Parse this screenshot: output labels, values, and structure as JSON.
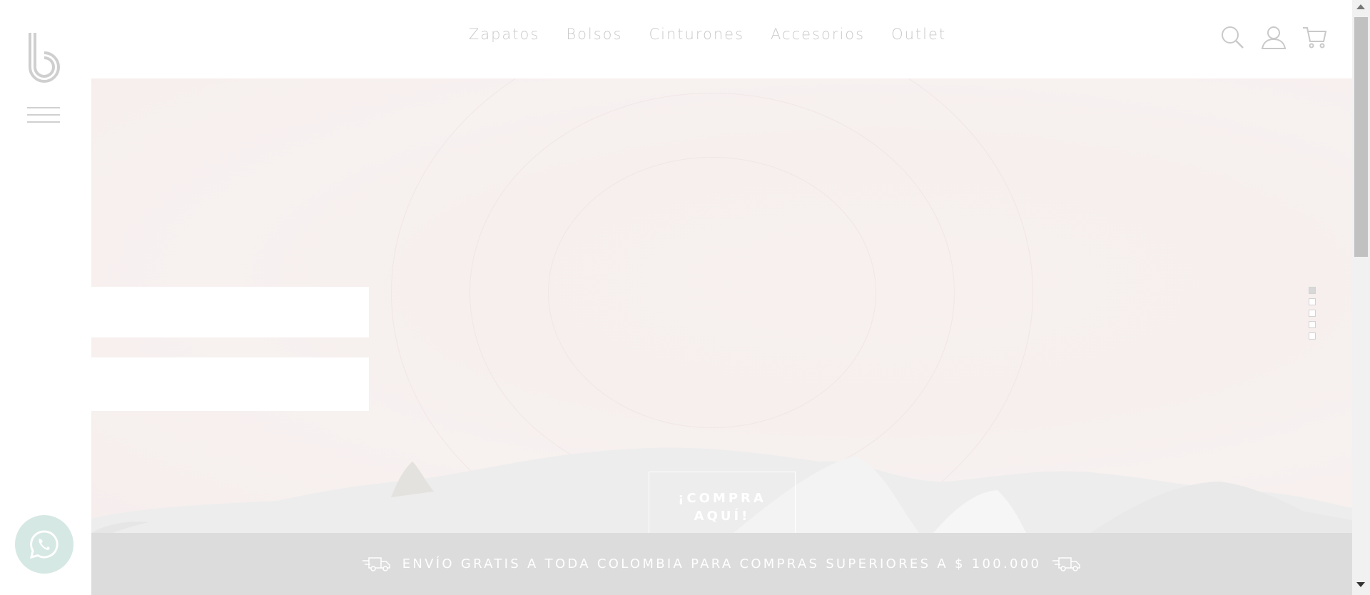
{
  "brand": {
    "logo_icon": "brand-b-logo"
  },
  "nav": {
    "items": [
      {
        "label": "Zapatos"
      },
      {
        "label": "Bolsos"
      },
      {
        "label": "Cinturones"
      },
      {
        "label": "Accesorios"
      },
      {
        "label": "Outlet"
      }
    ]
  },
  "header_icons": [
    "search-icon",
    "user-icon",
    "cart-icon"
  ],
  "hero": {
    "cta_line1": "¡COMPRA",
    "cta_line2": "AQUÍ!",
    "slides_total": 5,
    "active_slide": 1
  },
  "shipping_bar": {
    "text": "ENVÍO GRATIS A TODA COLOMBIA PARA COMPRAS SUPERIORES A $ 100.000"
  },
  "colors": {
    "hero_bg": "#f7f0ef",
    "ship_bar_bg": "#dcdcdc",
    "nav_text": "#c9c9c9",
    "whatsapp_bg": "#d5e8e3"
  }
}
